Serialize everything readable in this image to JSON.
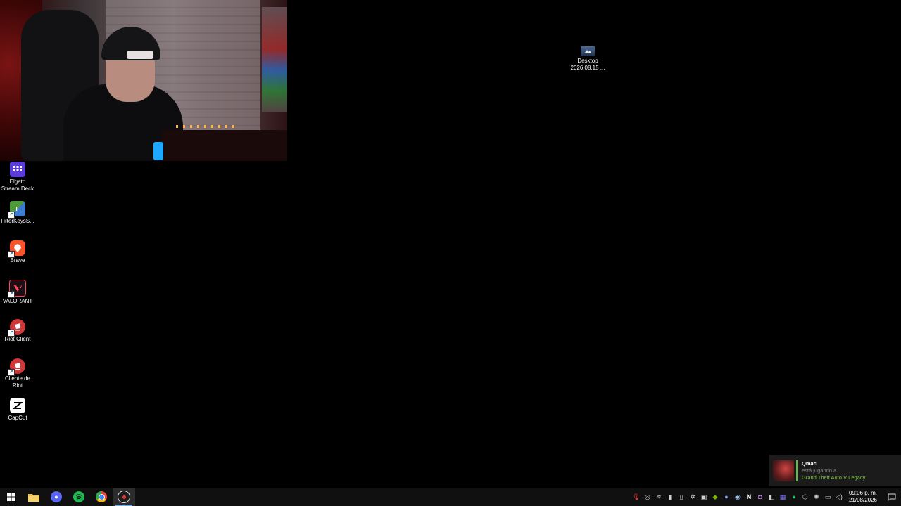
{
  "desktop": {
    "icons": [
      {
        "label": "Elgato\nStream Deck",
        "icon": "stream-deck-icon",
        "color": "#5b3bdc"
      },
      {
        "label": "FilterKeysS...",
        "icon": "filterkeys-icon",
        "color": "#4f9b3a"
      },
      {
        "label": "Brave",
        "icon": "brave-icon",
        "color": "#fb542b"
      },
      {
        "label": "VALORANT",
        "icon": "valorant-icon",
        "color": "#ff4655"
      },
      {
        "label": "Riot Client",
        "icon": "riot-client-icon",
        "color": "#d13639"
      },
      {
        "label": "Cliente de\nRiot",
        "icon": "riot-client-es-icon",
        "color": "#d13639"
      },
      {
        "label": "CapCut",
        "icon": "capcut-icon",
        "color": "#000000"
      }
    ],
    "folder": {
      "name": "Desktop",
      "date": "2026.08.15 ...",
      "icon": "folder-image-icon"
    }
  },
  "toast": {
    "name": "Qmac",
    "action": "está jugando a",
    "game": "Grand Theft Auto V Legacy",
    "accent": "#7fc44a"
  },
  "taskbar": {
    "apps": [
      {
        "name": "start",
        "icon": "windows-start-icon"
      },
      {
        "name": "file-explorer",
        "icon": "folder-icon"
      },
      {
        "name": "discord-badge",
        "icon": "discord-icon"
      },
      {
        "name": "spotify",
        "icon": "spotify-icon"
      },
      {
        "name": "chrome",
        "icon": "chrome-icon"
      },
      {
        "name": "obs",
        "icon": "obs-icon"
      }
    ],
    "clock": {
      "time": "09:06 p. m.",
      "date": "21/08/2026"
    }
  }
}
